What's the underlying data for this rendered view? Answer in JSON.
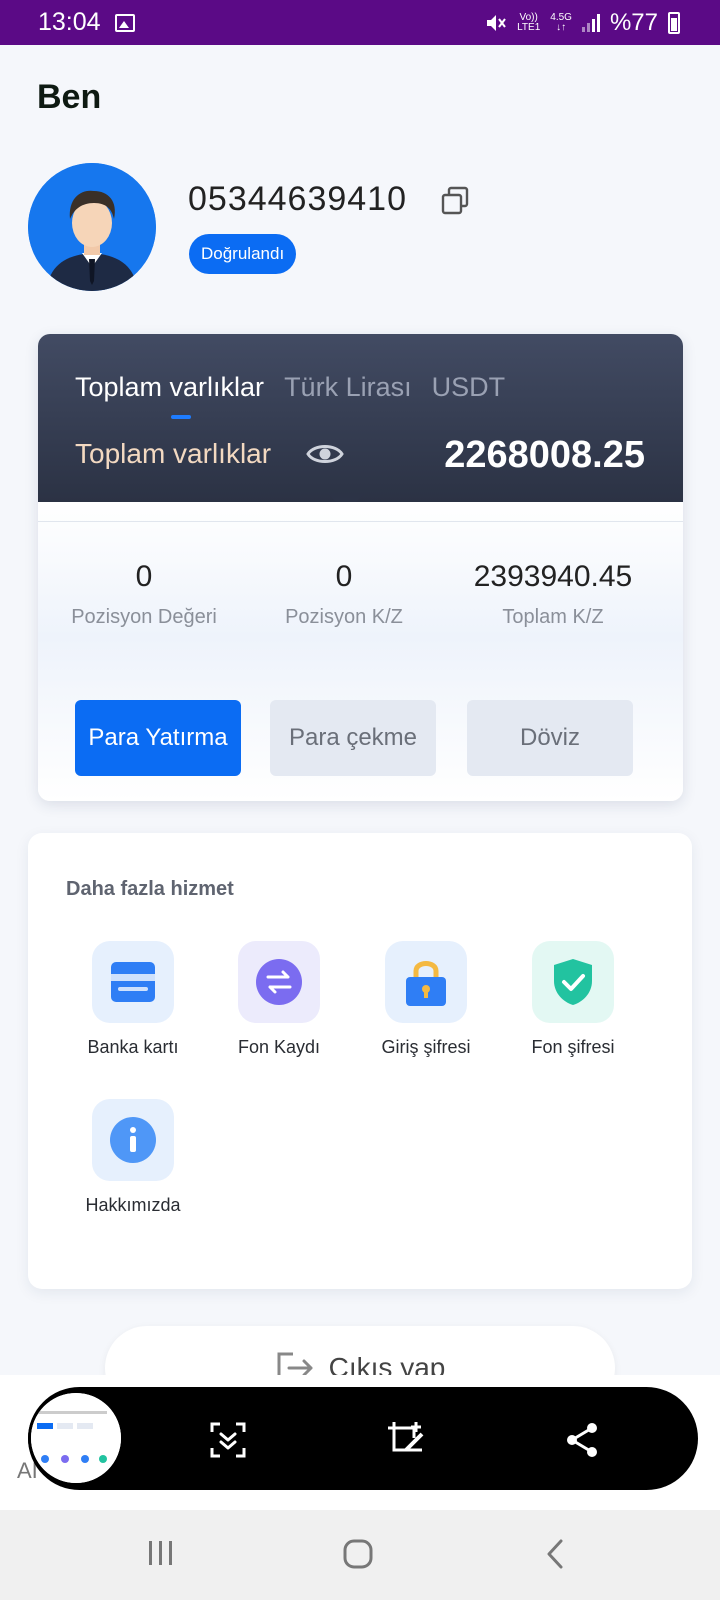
{
  "status_bar": {
    "time": "13:04",
    "network_top": "Vo))",
    "network_bottom": "LTE1",
    "network_gen": "4.5G",
    "battery": "%77"
  },
  "page": {
    "title": "Ben"
  },
  "profile": {
    "phone": "05344639410",
    "badge": "Doğrulandı"
  },
  "assets": {
    "tabs": [
      {
        "label": "Toplam varlıklar",
        "active": true
      },
      {
        "label": "Türk Lirası",
        "active": false
      },
      {
        "label": "USDT",
        "active": false
      }
    ],
    "total_label": "Toplam varlıklar",
    "total_value": "2268008.25",
    "stats": [
      {
        "value": "0",
        "label": "Pozisyon Değeri"
      },
      {
        "value": "0",
        "label": "Pozisyon K/Z"
      },
      {
        "value": "2393940.45",
        "label": "Toplam K/Z"
      }
    ],
    "buttons": {
      "deposit": "Para Yatırma",
      "withdraw": "Para çekme",
      "exchange": "Döviz"
    }
  },
  "services": {
    "title": "Daha fazla hizmet",
    "items": [
      {
        "label": "Banka kartı",
        "icon": "bank-card-icon"
      },
      {
        "label": "Fon Kaydı",
        "icon": "transfer-icon"
      },
      {
        "label": "Giriş şifresi",
        "icon": "lock-icon"
      },
      {
        "label": "Fon şifresi",
        "icon": "shield-check-icon"
      },
      {
        "label": "Hakkımızda",
        "icon": "info-icon"
      }
    ]
  },
  "logout": {
    "label": "Çıkış yap"
  },
  "screenshot_toolbar": {
    "side_label": "AI"
  },
  "colors": {
    "status_bar": "#5b0a86",
    "primary": "#0b6cf3",
    "card_dark": "#2b3244",
    "asset_label": "#f3d9c1"
  }
}
